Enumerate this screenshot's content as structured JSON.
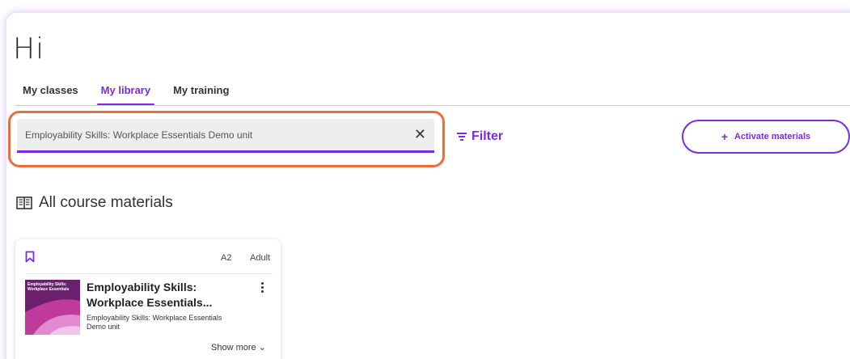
{
  "header": {
    "greeting": "Hi"
  },
  "tabs": [
    {
      "label": "My classes",
      "active": false
    },
    {
      "label": "My library",
      "active": true
    },
    {
      "label": "My training",
      "active": false
    }
  ],
  "search": {
    "value": "Employability Skills: Workplace Essentials Demo unit",
    "clear_icon": "close-icon"
  },
  "filter": {
    "label": "Filter",
    "icon": "filter-icon"
  },
  "activate": {
    "label": "Activate materials",
    "icon": "plus-icon"
  },
  "section": {
    "title": "All course materials",
    "icon": "book-icon"
  },
  "card": {
    "level": "A2",
    "audience": "Adult",
    "cover_text": "Employability Skills: Workplace Essentials",
    "title": "Employability Skills: Workplace Essentials...",
    "subtitle": "Employability Skills: Workplace Essentials Demo unit",
    "show_more": "Show more",
    "bookmark_icon": "bookmark-icon",
    "menu_icon": "kebab-menu-icon"
  },
  "colors": {
    "accent": "#7a2be0",
    "highlight": "#ee6b3c",
    "cover": "#6b1f6e"
  }
}
